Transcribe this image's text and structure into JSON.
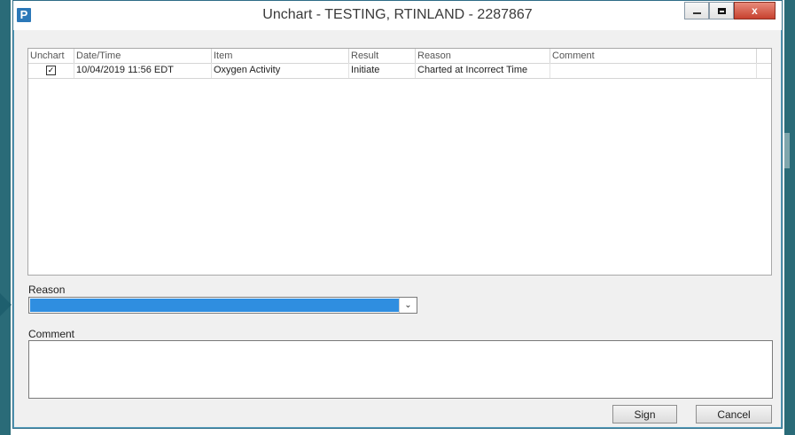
{
  "window": {
    "title": "Unchart - TESTING, RTINLAND - 2287867",
    "app_icon_letter": "P",
    "controls": {
      "minimize": "minimize-icon",
      "maximize": "maximize-icon",
      "close": "close-icon",
      "close_glyph": "x"
    }
  },
  "grid": {
    "columns": [
      "Unchart",
      "Date/Time",
      "Item",
      "Result",
      "Reason",
      "Comment"
    ],
    "rows": [
      {
        "unchart_checked": true,
        "date_time": "10/04/2019 11:56 EDT",
        "item": "Oxygen Activity",
        "result": "Initiate",
        "reason": "Charted at Incorrect Time",
        "comment": ""
      }
    ]
  },
  "reason_field": {
    "label": "Reason",
    "value": "",
    "arrow_glyph": "⌄"
  },
  "comment_field": {
    "label": "Comment",
    "value": ""
  },
  "buttons": {
    "sign": "Sign",
    "cancel": "Cancel"
  },
  "colors": {
    "selection": "#2f8ee0",
    "frame": "#2a6b78",
    "close_button": "#c7412f"
  }
}
